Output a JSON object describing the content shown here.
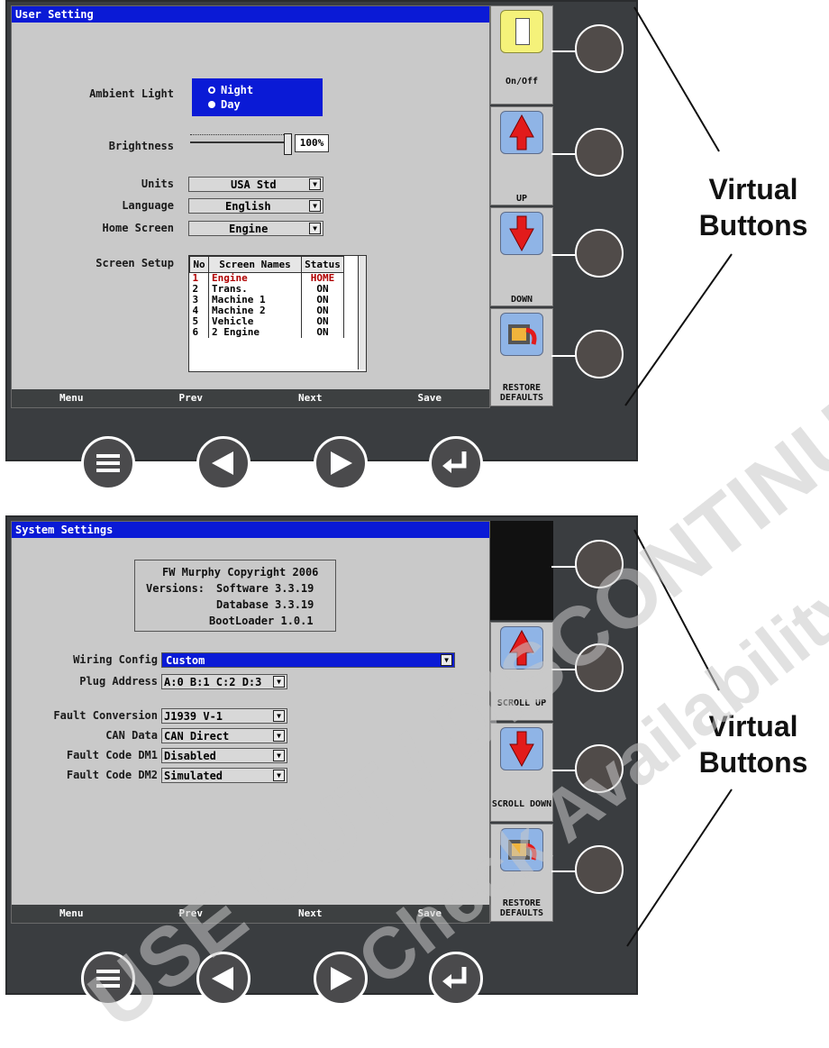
{
  "callouts": {
    "line1": "Virtual",
    "line2": "Buttons"
  },
  "user_setting": {
    "title": "User Setting",
    "ambient_label": "Ambient Light",
    "ambient_options": [
      "Night",
      "Day"
    ],
    "brightness_label": "Brightness",
    "brightness_value": "100%",
    "brightness_level": 1.0,
    "units_label": "Units",
    "units_value": "USA Std",
    "language_label": "Language",
    "language_value": "English",
    "home_label": "Home Screen",
    "home_value": "Engine",
    "screen_setup_label": "Screen Setup",
    "table": {
      "headers": [
        "No",
        "Screen Names",
        "Status"
      ],
      "rows": [
        [
          "1",
          "Engine",
          "HOME"
        ],
        [
          "2",
          "Trans.",
          "ON"
        ],
        [
          "3",
          "Machine 1",
          "ON"
        ],
        [
          "4",
          "Machine 2",
          "ON"
        ],
        [
          "5",
          "Vehicle",
          "ON"
        ],
        [
          "6",
          "2 Engine",
          "ON"
        ]
      ]
    },
    "softkeys": [
      "Menu",
      "Prev",
      "Next",
      "Save"
    ],
    "side_buttons": [
      "On/Off",
      "UP",
      "DOWN",
      "RESTORE DEFAULTS"
    ]
  },
  "system_settings": {
    "title": "System Settings",
    "copyright": "FW Murphy Copyright 2006",
    "versions_label": "Versions:",
    "software": "Software 3.3.19",
    "database": "Database 3.3.19",
    "bootloader": "BootLoader 1.0.1",
    "wiring_label": "Wiring Config",
    "wiring_value": "Custom",
    "plug_label": "Plug Address",
    "plug_value": "A:0 B:1 C:2 D:3",
    "fault_conv_label": "Fault Conversion",
    "fault_conv_value": "J1939 V-1",
    "can_label": "CAN Data",
    "can_value": "CAN Direct",
    "dm1_label": "Fault Code DM1",
    "dm1_value": "Disabled",
    "dm2_label": "Fault Code DM2",
    "dm2_value": "Simulated",
    "softkeys": [
      "Menu",
      "Prev",
      "Next",
      "Save"
    ],
    "side_buttons": [
      "SCROLL UP",
      "SCROLL DOWN",
      "RESTORE DEFAULTS"
    ]
  },
  "watermark": {
    "line1": "USE OUT / DISCONTINUED",
    "line2": "Check Availability"
  },
  "colors": {
    "title_bar": "#0a1ad6",
    "panel": "#3a3d40",
    "screen": "#c9c9c9",
    "highlight_red": "#b00000"
  }
}
